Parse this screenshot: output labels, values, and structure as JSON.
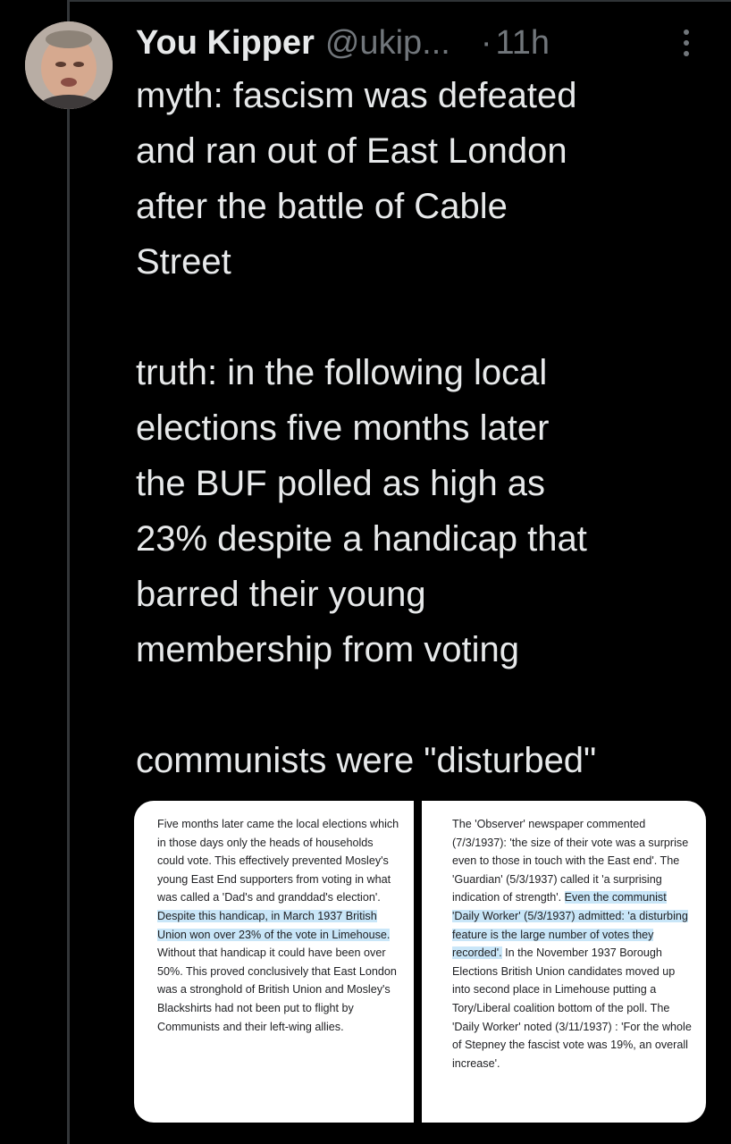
{
  "tweet": {
    "author_name": "You Kipper",
    "author_handle": "@ukip...",
    "separator": "·",
    "time": "11h",
    "text": "myth: fascism was defeated\nand ran out of East London\nafter the battle of Cable\nStreet\n\ntruth: in the following local\nelections five months later\nthe BUF polled as high as\n23% despite a handicap that\nbarred their young\nmembership from voting\n\ncommunists were \"disturbed\""
  },
  "icons": {
    "avatar": "avatar",
    "more": "more-options-icon"
  },
  "colors": {
    "background": "#000000",
    "text": "#e7e9ea",
    "secondary": "#71767b",
    "highlight": "#c9e6f8"
  },
  "images": {
    "left": {
      "before": "Five months later came the local elections which in those days only the heads of households could vote. This effectively prevented Mosley's young East End supporters from voting in what was called a 'Dad's and granddad's election'. ",
      "highlight": "Despite this handicap, in March 1937 British Union won over 23% of the vote in Limehouse.",
      "after": " Without that handicap it could have been over 50%. This proved conclusively that East London was a stronghold of British Union and Mosley's Blackshirts had not been put to flight by Communists and their left-wing allies."
    },
    "right": {
      "before": "The 'Observer' newspaper commented (7/3/1937): 'the size of their vote was a surprise even to those in touch with the East end'. The 'Guardian' (5/3/1937) called it 'a surprising indication of strength'. ",
      "highlight": "Even the communist 'Daily Worker' (5/3/1937) admitted: 'a disturbing feature is the large number of votes they recorded'.",
      "after": " In the November 1937 Borough Elections British Union candidates moved up into second place in Limehouse putting a Tory/Liberal coalition bottom of the poll. The 'Daily Worker' noted (3/11/1937) : 'For the whole of Stepney the fascist vote was 19%, an overall increase'."
    }
  }
}
